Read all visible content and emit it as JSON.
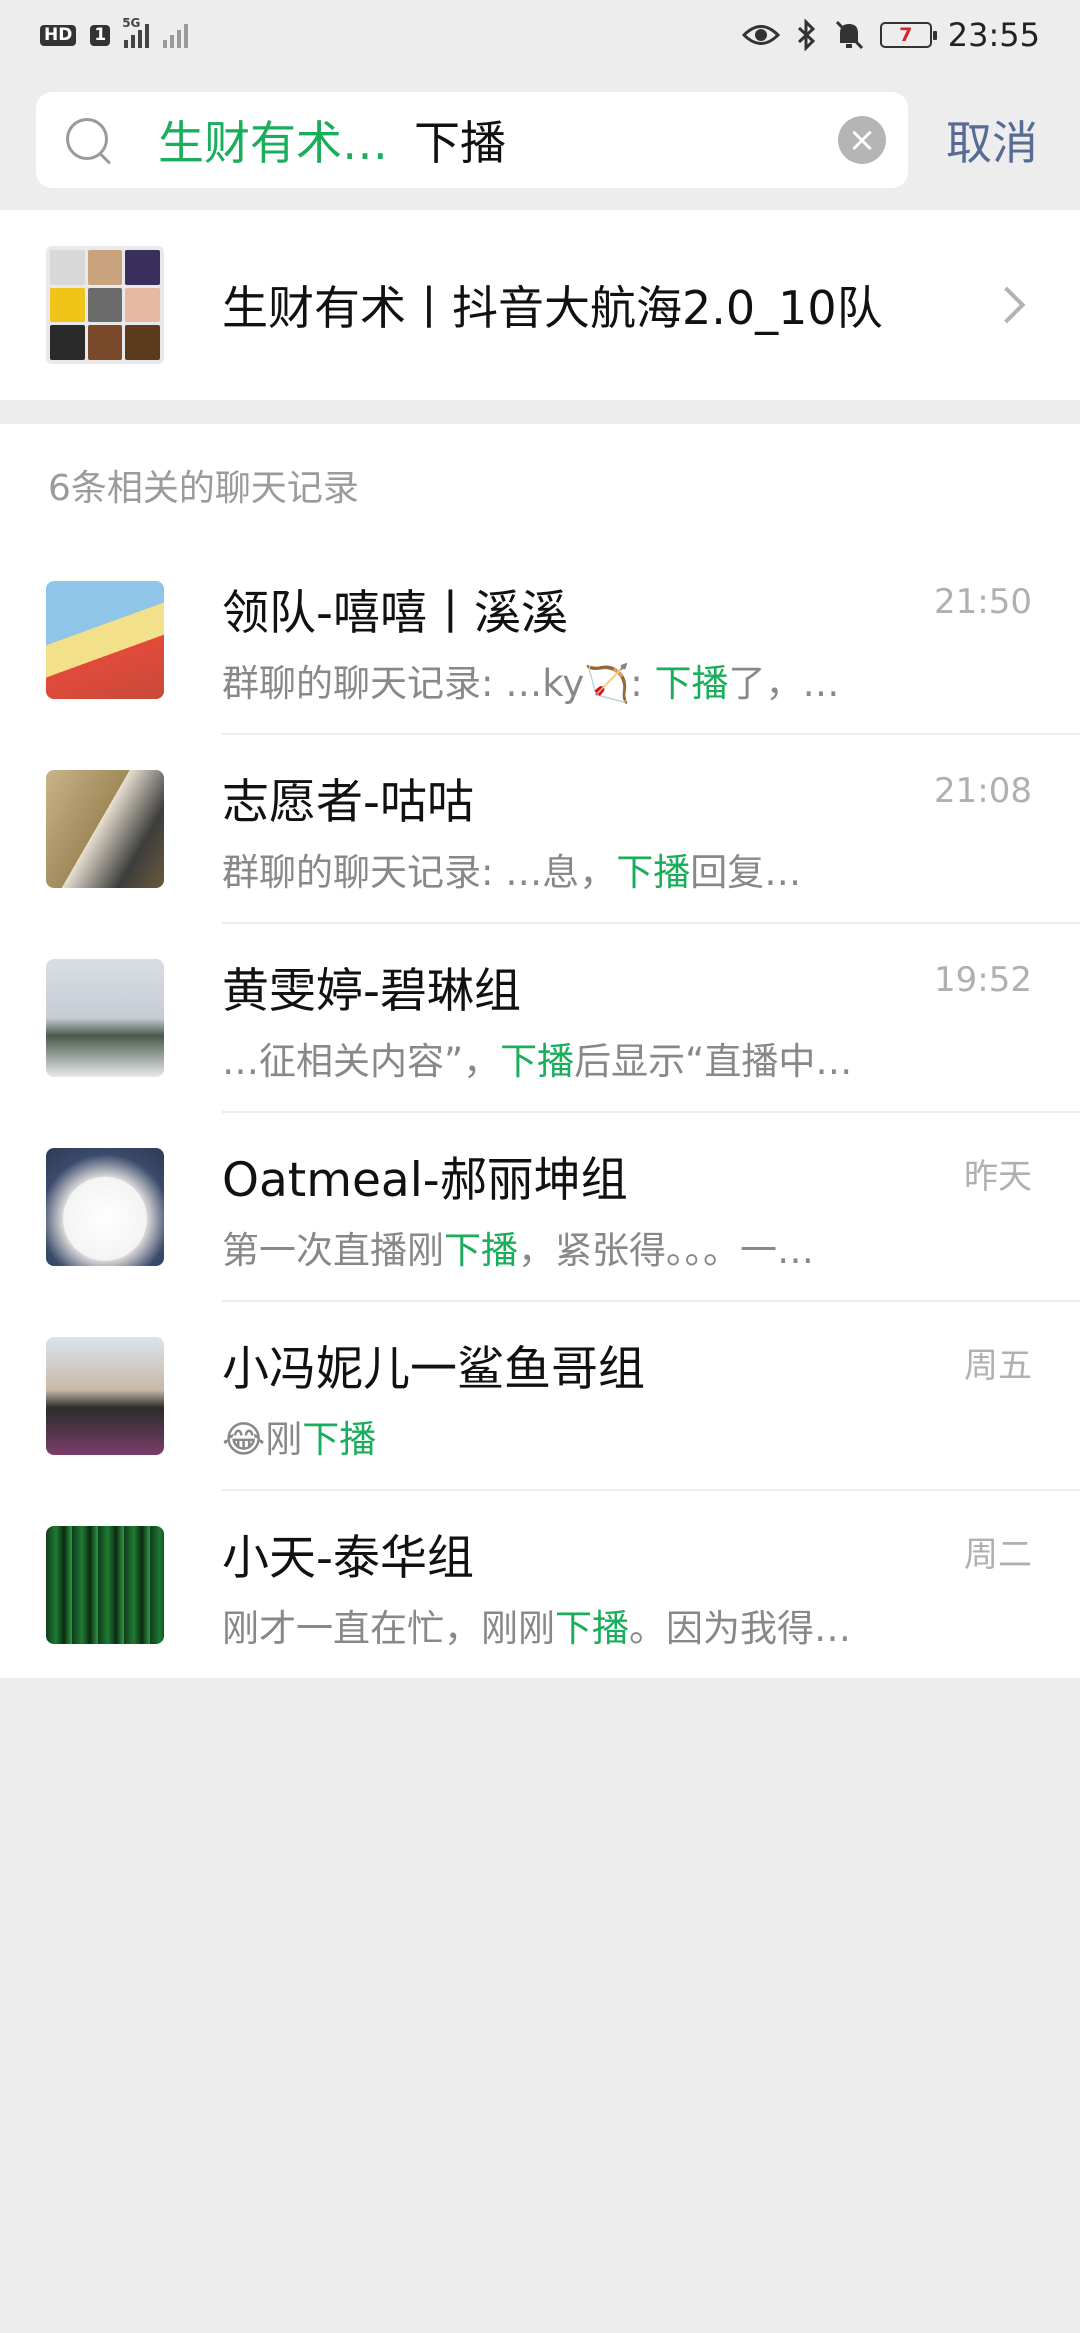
{
  "status_bar": {
    "hd": "HD",
    "sim": "1",
    "net": "5G",
    "time": "23:55",
    "battery": "7"
  },
  "search": {
    "tag": "生财有术…",
    "query": "下播",
    "cancel_label": "取消"
  },
  "group_result": {
    "name": "生财有术丨抖音大航海2.0_10队"
  },
  "records": {
    "header": "6条相关的聊天记录",
    "items": [
      {
        "name": "领队-嘻嘻丨溪溪",
        "time": "21:50",
        "pre": "群聊的聊天记录: …ky🏹: ",
        "hl": "下播",
        "post": "了，…"
      },
      {
        "name": "志愿者-咕咕",
        "time": "21:08",
        "pre": "群聊的聊天记录: …息，",
        "hl": "下播",
        "post": "回复…"
      },
      {
        "name": "黄雯婷-碧琳组",
        "time": "19:52",
        "pre": "…征相关内容”，",
        "hl": "下播",
        "post": "后显示“直播中…"
      },
      {
        "name": "Oatmeal-郝丽坤组",
        "time": "昨天",
        "pre": "第一次直播刚",
        "hl": "下播",
        "post": "，紧张得。。。一…"
      },
      {
        "name": "小冯妮儿一鲨鱼哥组",
        "time": "周五",
        "pre": "😂刚",
        "hl": "下播",
        "post": ""
      },
      {
        "name": "小天-泰华组",
        "time": "周二",
        "pre": "刚才一直在忙，刚刚",
        "hl": "下播",
        "post": "。因为我得…"
      }
    ]
  },
  "colors": {
    "highlight": "#1aad5b",
    "link": "#576b95",
    "background": "#ededed"
  }
}
